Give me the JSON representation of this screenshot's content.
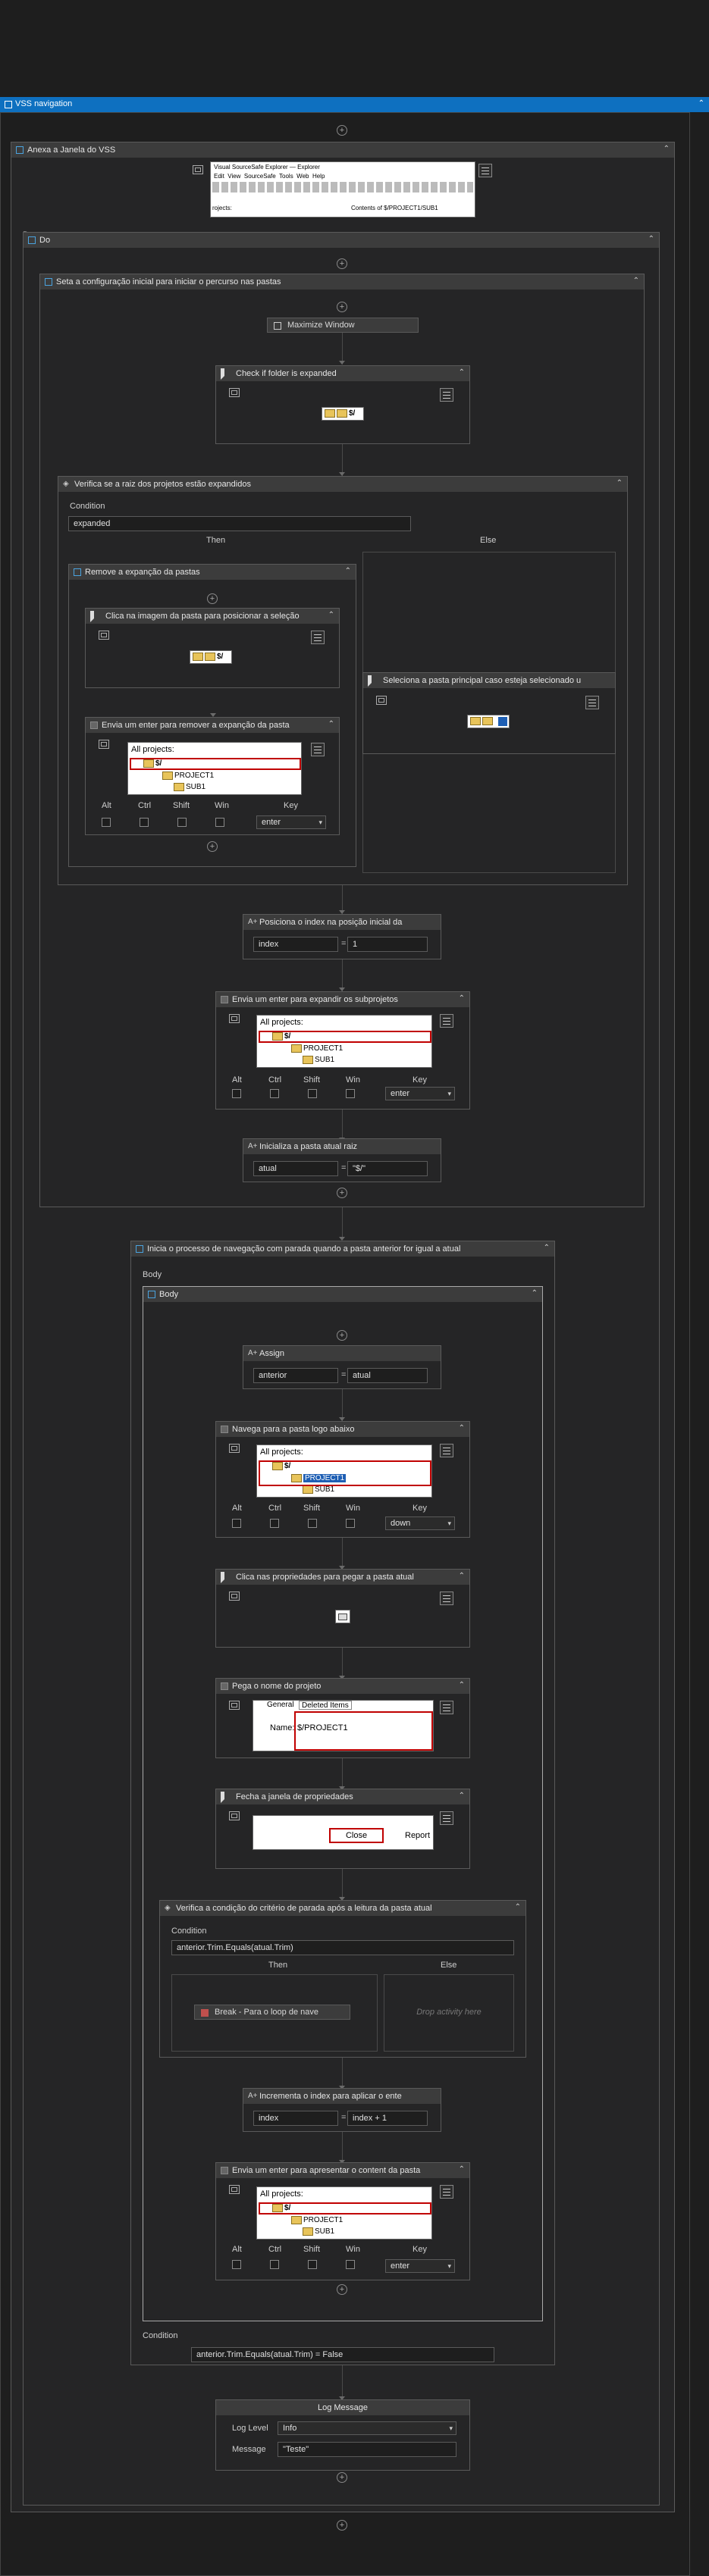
{
  "header": {
    "title": "VSS navigation"
  },
  "attach": {
    "title": "Anexa a Janela do VSS",
    "thumb_title": "Visual SourceSafe Explorer — Explorer",
    "thumb_menu": [
      "Edit",
      "View",
      "SourceSafe",
      "Tools",
      "Web",
      "Help"
    ],
    "thumb_left": "rojects:",
    "thumb_right": "Contents of $/PROJECT1/SUB1"
  },
  "do_label": "Do",
  "setup": {
    "title": "Seta a configuração inicial para iniciar o percurso nas pastas"
  },
  "maximize": {
    "title": "Maximize Window"
  },
  "check_expanded": {
    "title": "Check if folder is expanded",
    "thumb": "$/"
  },
  "verify_root": {
    "title": "Verifica se a raiz dos projetos estão expandidos",
    "condition_label": "Condition",
    "condition": "expanded",
    "then_label": "Then",
    "else_label": "Else"
  },
  "remove_expand": {
    "title": "Remove a expanção da pastas"
  },
  "click_image": {
    "title": "Clica na imagem da pasta para posicionar a seleção",
    "thumb": "$/"
  },
  "enter_remove": {
    "title": "Envia um enter para remover a expanção da pasta",
    "tree": [
      "All projects:",
      "$/",
      "PROJECT1",
      "SUB1"
    ],
    "key": "enter"
  },
  "select_main": {
    "title": "Seleciona a pasta principal caso esteja selecionado u"
  },
  "modifiers": {
    "alt": "Alt",
    "ctrl": "Ctrl",
    "shift": "Shift",
    "win": "Win",
    "key": "Key"
  },
  "position_index": {
    "title": "Posiciona o index na posição inicial da",
    "to": "index",
    "value": "1"
  },
  "enter_expand": {
    "title": "Envia um enter para expandir os subprojetos",
    "tree": [
      "All projects:",
      "$/",
      "PROJECT1",
      "SUB1"
    ],
    "key": "enter"
  },
  "init_current": {
    "title": "Inicializa a pasta atual raiz",
    "to": "atual",
    "value": "\"$/\""
  },
  "loop": {
    "title": "Inicia o processo de navegação com parada quando a pasta anterior for igual a atual",
    "body_label": "Body",
    "body_seq": "Body",
    "condition_label": "Condition",
    "condition": "anterior.Trim.Equals(atual.Trim) = False"
  },
  "assign": {
    "title": "Assign",
    "to": "anterior",
    "value": "atual"
  },
  "navigate_down": {
    "title": "Navega para a pasta logo abaixo",
    "tree": [
      "All projects:",
      "$/",
      "PROJECT1",
      "SUB1"
    ],
    "key": "down"
  },
  "click_props": {
    "title": "Clica nas propriedades para pegar a pasta atual"
  },
  "get_name": {
    "title": "Pega o nome do projeto",
    "tab1": "General",
    "tab2": "Deleted Items",
    "name_label": "Name:",
    "name_value": "$/PROJECT1"
  },
  "close_props": {
    "title": "Fecha a janela de propriedades",
    "close": "Close",
    "report": "Report"
  },
  "verify_stop": {
    "title": "Verifica a condição do critério de parada após a leitura da pasta atual",
    "condition_label": "Condition",
    "condition": "anterior.Trim.Equals(atual.Trim)",
    "then_label": "Then",
    "else_label": "Else",
    "break": "Break - Para o loop de nave",
    "drop": "Drop activity here"
  },
  "increment": {
    "title": "Incrementa o index para aplicar o ente",
    "to": "index",
    "value": "index + 1"
  },
  "enter_content": {
    "title": "Envia um enter para apresentar o content da pasta",
    "tree": [
      "All projects:",
      "$/",
      "PROJECT1",
      "SUB1"
    ],
    "key": "enter"
  },
  "log": {
    "title": "Log Message",
    "level_label": "Log Level",
    "level": "Info",
    "message_label": "Message",
    "message": "\"Teste\""
  },
  "colors": {
    "accent": "#007acc",
    "border": "#5a5a5a",
    "panel": "#252526",
    "header": "#3c3c3c",
    "highlight": "#c00000"
  }
}
